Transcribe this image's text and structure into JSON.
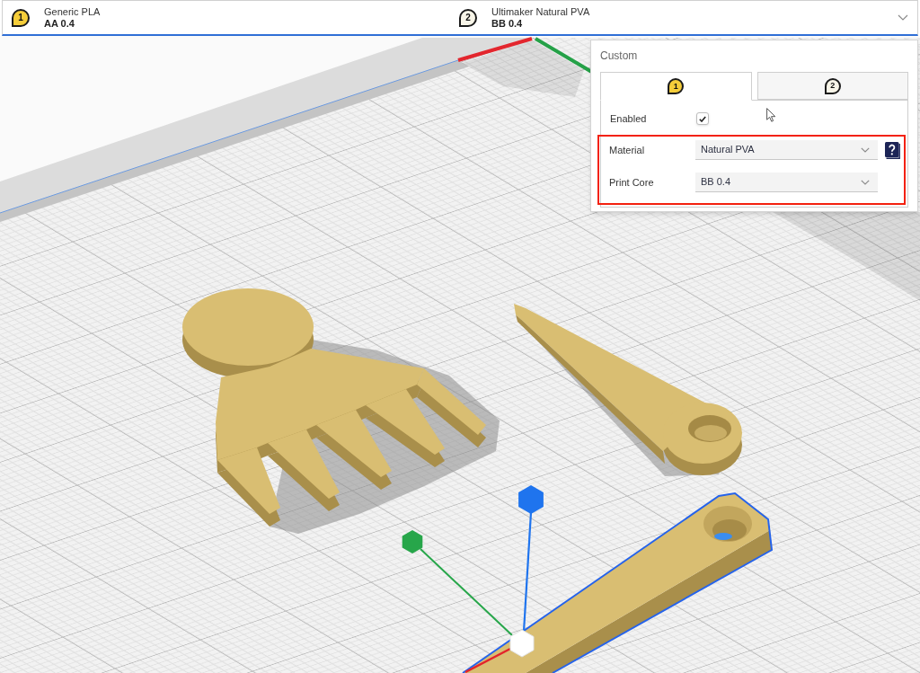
{
  "extruder_bar": {
    "expanded": true,
    "extruders": [
      {
        "number": "1",
        "color": "#f5cd3a",
        "material": "Generic PLA",
        "print_core": "AA 0.4"
      },
      {
        "number": "2",
        "color": "#f8f5e8",
        "material": "Ultimaker Natural PVA",
        "print_core": "BB 0.4"
      }
    ]
  },
  "scene": {
    "objects": [
      {
        "kind": "rake",
        "selected": false
      },
      {
        "kind": "wedge",
        "selected": false
      },
      {
        "kind": "wedge",
        "selected": true
      }
    ]
  },
  "extruder_panel": {
    "title": "Custom",
    "tabs": [
      {
        "number": "1",
        "color": "#f5cd3a",
        "selected": true
      },
      {
        "number": "2",
        "color": "#f8f5e8",
        "selected": false
      }
    ],
    "rows": [
      {
        "kind": "checkbox",
        "label": "Enabled",
        "checked": true,
        "highlighted": false
      },
      {
        "kind": "dropdown",
        "label": "Material",
        "value": "Natural PVA",
        "help": true,
        "highlighted": true
      },
      {
        "kind": "dropdown",
        "label": "Print Core",
        "value": "BB 0.4",
        "help": false,
        "highlighted": true
      }
    ]
  }
}
